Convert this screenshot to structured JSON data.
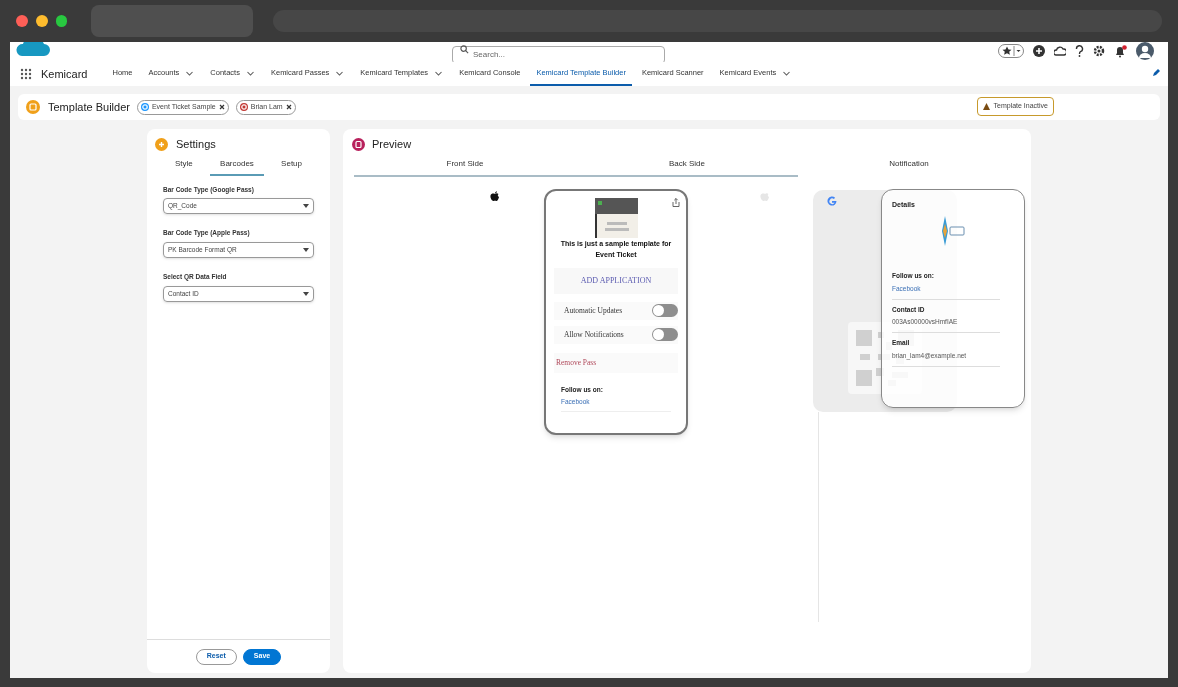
{
  "header": {
    "search_placeholder": "Search...",
    "notifications": true
  },
  "app": {
    "name": "Kemicard"
  },
  "nav": [
    {
      "label": "Home",
      "has_menu": false,
      "selected": false
    },
    {
      "label": "Accounts",
      "has_menu": true,
      "selected": false
    },
    {
      "label": "Contacts",
      "has_menu": true,
      "selected": false
    },
    {
      "label": "Kemicard Passes",
      "has_menu": true,
      "selected": false
    },
    {
      "label": "Kemicard Templates",
      "has_menu": true,
      "selected": false
    },
    {
      "label": "Kemicard Console",
      "has_menu": false,
      "selected": false
    },
    {
      "label": "Kemicard Template Builder",
      "has_menu": false,
      "selected": true
    },
    {
      "label": "Kemicard Scanner",
      "has_menu": false,
      "selected": false
    },
    {
      "label": "Kemicard Events",
      "has_menu": true,
      "selected": false
    }
  ],
  "page": {
    "title": "Template Builder",
    "record_tabs": [
      {
        "label": "Event Ticket Sample",
        "kind": "template"
      },
      {
        "label": "Brian Lam",
        "kind": "contact"
      }
    ],
    "status_badge": "Template Inactive"
  },
  "settings": {
    "title": "Settings",
    "tabs": [
      {
        "label": "Style",
        "selected": false
      },
      {
        "label": "Barcodes",
        "selected": true
      },
      {
        "label": "Setup",
        "selected": false
      }
    ],
    "fields": [
      {
        "label": "Bar Code Type (Google Pass)",
        "value": "QR_Code"
      },
      {
        "label": "Bar Code Type (Apple Pass)",
        "value": "PK Barcode Format QR"
      },
      {
        "label": "Select QR Data Field",
        "value": "Contact ID"
      }
    ],
    "buttons": [
      {
        "label": "Reset",
        "kind": "neutral"
      },
      {
        "label": "Save",
        "kind": "brand"
      }
    ]
  },
  "preview": {
    "title": "Preview",
    "tabs": [
      {
        "label": "Front Side",
        "selected": true
      },
      {
        "label": "Back Side",
        "selected": true
      },
      {
        "label": "Notification",
        "selected": false
      }
    ],
    "apple_pass": {
      "heading": "This is just a sample template for Event Ticket",
      "action": "ADD APPLICATION",
      "toggles": [
        {
          "label": "Automatic Updates",
          "on": false
        },
        {
          "label": "Allow Notifications",
          "on": false
        }
      ],
      "remove": "Remove Pass",
      "follow_label": "Follow us on:",
      "follow_link": "Facebook"
    },
    "google_details": {
      "title": "Details",
      "fields": [
        {
          "label": "Follow us on:",
          "value": "Facebook",
          "kind": "link"
        },
        {
          "label": "Contact ID",
          "value": "003As00000vsHmfIAE",
          "kind": "text"
        },
        {
          "label": "Email",
          "value": "brian_lam4@example.net",
          "kind": "text"
        }
      ]
    }
  }
}
